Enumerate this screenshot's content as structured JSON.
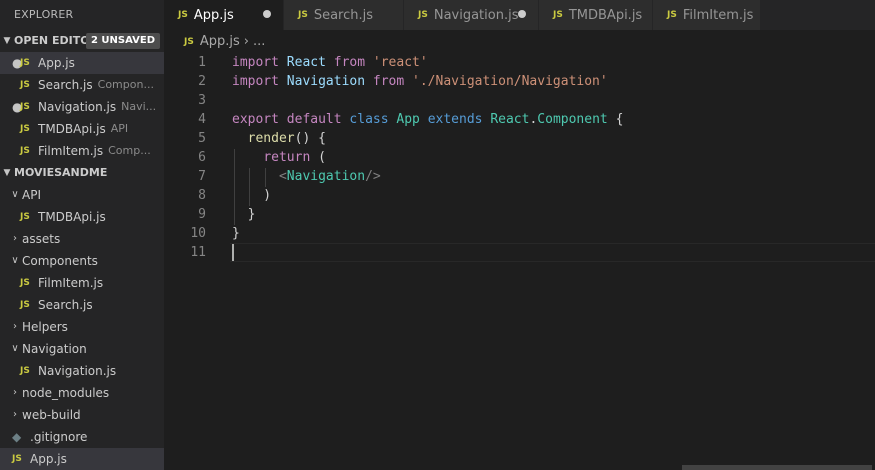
{
  "explorer": {
    "title": "EXPLORER"
  },
  "open_editors": {
    "label": "OPEN EDITO...",
    "badge": "2 UNSAVED",
    "items": [
      {
        "name": "App.js",
        "desc": "",
        "modified": true,
        "selected": true
      },
      {
        "name": "Search.js",
        "desc": "Compon...",
        "modified": false,
        "selected": false
      },
      {
        "name": "Navigation.js",
        "desc": "Navi...",
        "modified": true,
        "selected": false
      },
      {
        "name": "TMDBApi.js",
        "desc": "API",
        "modified": false,
        "selected": false
      },
      {
        "name": "FilmItem.js",
        "desc": "Comp...",
        "modified": false,
        "selected": false
      }
    ]
  },
  "project": {
    "label": "MOVIESANDME",
    "tree": [
      {
        "type": "folder",
        "open": true,
        "name": "API",
        "depth": 0
      },
      {
        "type": "js",
        "name": "TMDBApi.js",
        "depth": 1
      },
      {
        "type": "folder",
        "open": false,
        "name": "assets",
        "depth": 0
      },
      {
        "type": "folder",
        "open": true,
        "name": "Components",
        "depth": 0
      },
      {
        "type": "js",
        "name": "FilmItem.js",
        "depth": 1
      },
      {
        "type": "js",
        "name": "Search.js",
        "depth": 1
      },
      {
        "type": "folder",
        "open": false,
        "name": "Helpers",
        "depth": 0
      },
      {
        "type": "folder",
        "open": true,
        "name": "Navigation",
        "depth": 0
      },
      {
        "type": "js",
        "name": "Navigation.js",
        "depth": 1
      },
      {
        "type": "folder",
        "open": false,
        "name": "node_modules",
        "depth": 0
      },
      {
        "type": "folder",
        "open": false,
        "name": "web-build",
        "depth": 0
      },
      {
        "type": "git",
        "name": ".gitignore",
        "depth": 0
      },
      {
        "type": "js",
        "name": "App.js",
        "depth": 0,
        "selected": true
      }
    ]
  },
  "tabs": [
    {
      "label": "App.js",
      "active": true,
      "modified": true
    },
    {
      "label": "Search.js",
      "active": false,
      "modified": false
    },
    {
      "label": "Navigation.js",
      "active": false,
      "modified": true
    },
    {
      "label": "TMDBApi.js",
      "active": false,
      "modified": false
    },
    {
      "label": "FilmItem.js",
      "active": false,
      "modified": false
    }
  ],
  "breadcrumb": {
    "file": "App.js",
    "rest": "..."
  },
  "js_badge": "JS",
  "editor": {
    "current_line": 11,
    "lines": [
      {
        "n": "1",
        "tokens": [
          [
            "kw2",
            "import "
          ],
          [
            "var",
            "React "
          ],
          [
            "kw2",
            "from "
          ],
          [
            "str",
            "'react'"
          ]
        ]
      },
      {
        "n": "2",
        "tokens": [
          [
            "kw2",
            "import "
          ],
          [
            "var",
            "Navigation "
          ],
          [
            "kw2",
            "from "
          ],
          [
            "str",
            "'./Navigation/Navigation'"
          ]
        ]
      },
      {
        "n": "3",
        "tokens": []
      },
      {
        "n": "4",
        "tokens": [
          [
            "kw2",
            "export "
          ],
          [
            "kw2",
            "default "
          ],
          [
            "kw",
            "class "
          ],
          [
            "cls",
            "App "
          ],
          [
            "kw",
            "extends "
          ],
          [
            "cls",
            "React"
          ],
          [
            "",
            "."
          ],
          [
            "cls",
            "Component"
          ],
          [
            "",
            " {"
          ]
        ]
      },
      {
        "n": "5",
        "tokens": [
          [
            "",
            "  "
          ],
          [
            "fn",
            "render"
          ],
          [
            "",
            "() {"
          ]
        ]
      },
      {
        "n": "6",
        "tokens": [
          [
            "",
            "    "
          ],
          [
            "kw2",
            "return"
          ],
          [
            "",
            " ("
          ]
        ]
      },
      {
        "n": "7",
        "tokens": [
          [
            "",
            "      "
          ],
          [
            "tag",
            "<"
          ],
          [
            "cls",
            "Navigation"
          ],
          [
            "tag",
            "/>"
          ]
        ]
      },
      {
        "n": "8",
        "tokens": [
          [
            "",
            "    )"
          ]
        ]
      },
      {
        "n": "9",
        "tokens": [
          [
            "",
            "  }"
          ]
        ]
      },
      {
        "n": "10",
        "tokens": [
          [
            "",
            "}"
          ]
        ]
      },
      {
        "n": "11",
        "tokens": []
      }
    ]
  }
}
